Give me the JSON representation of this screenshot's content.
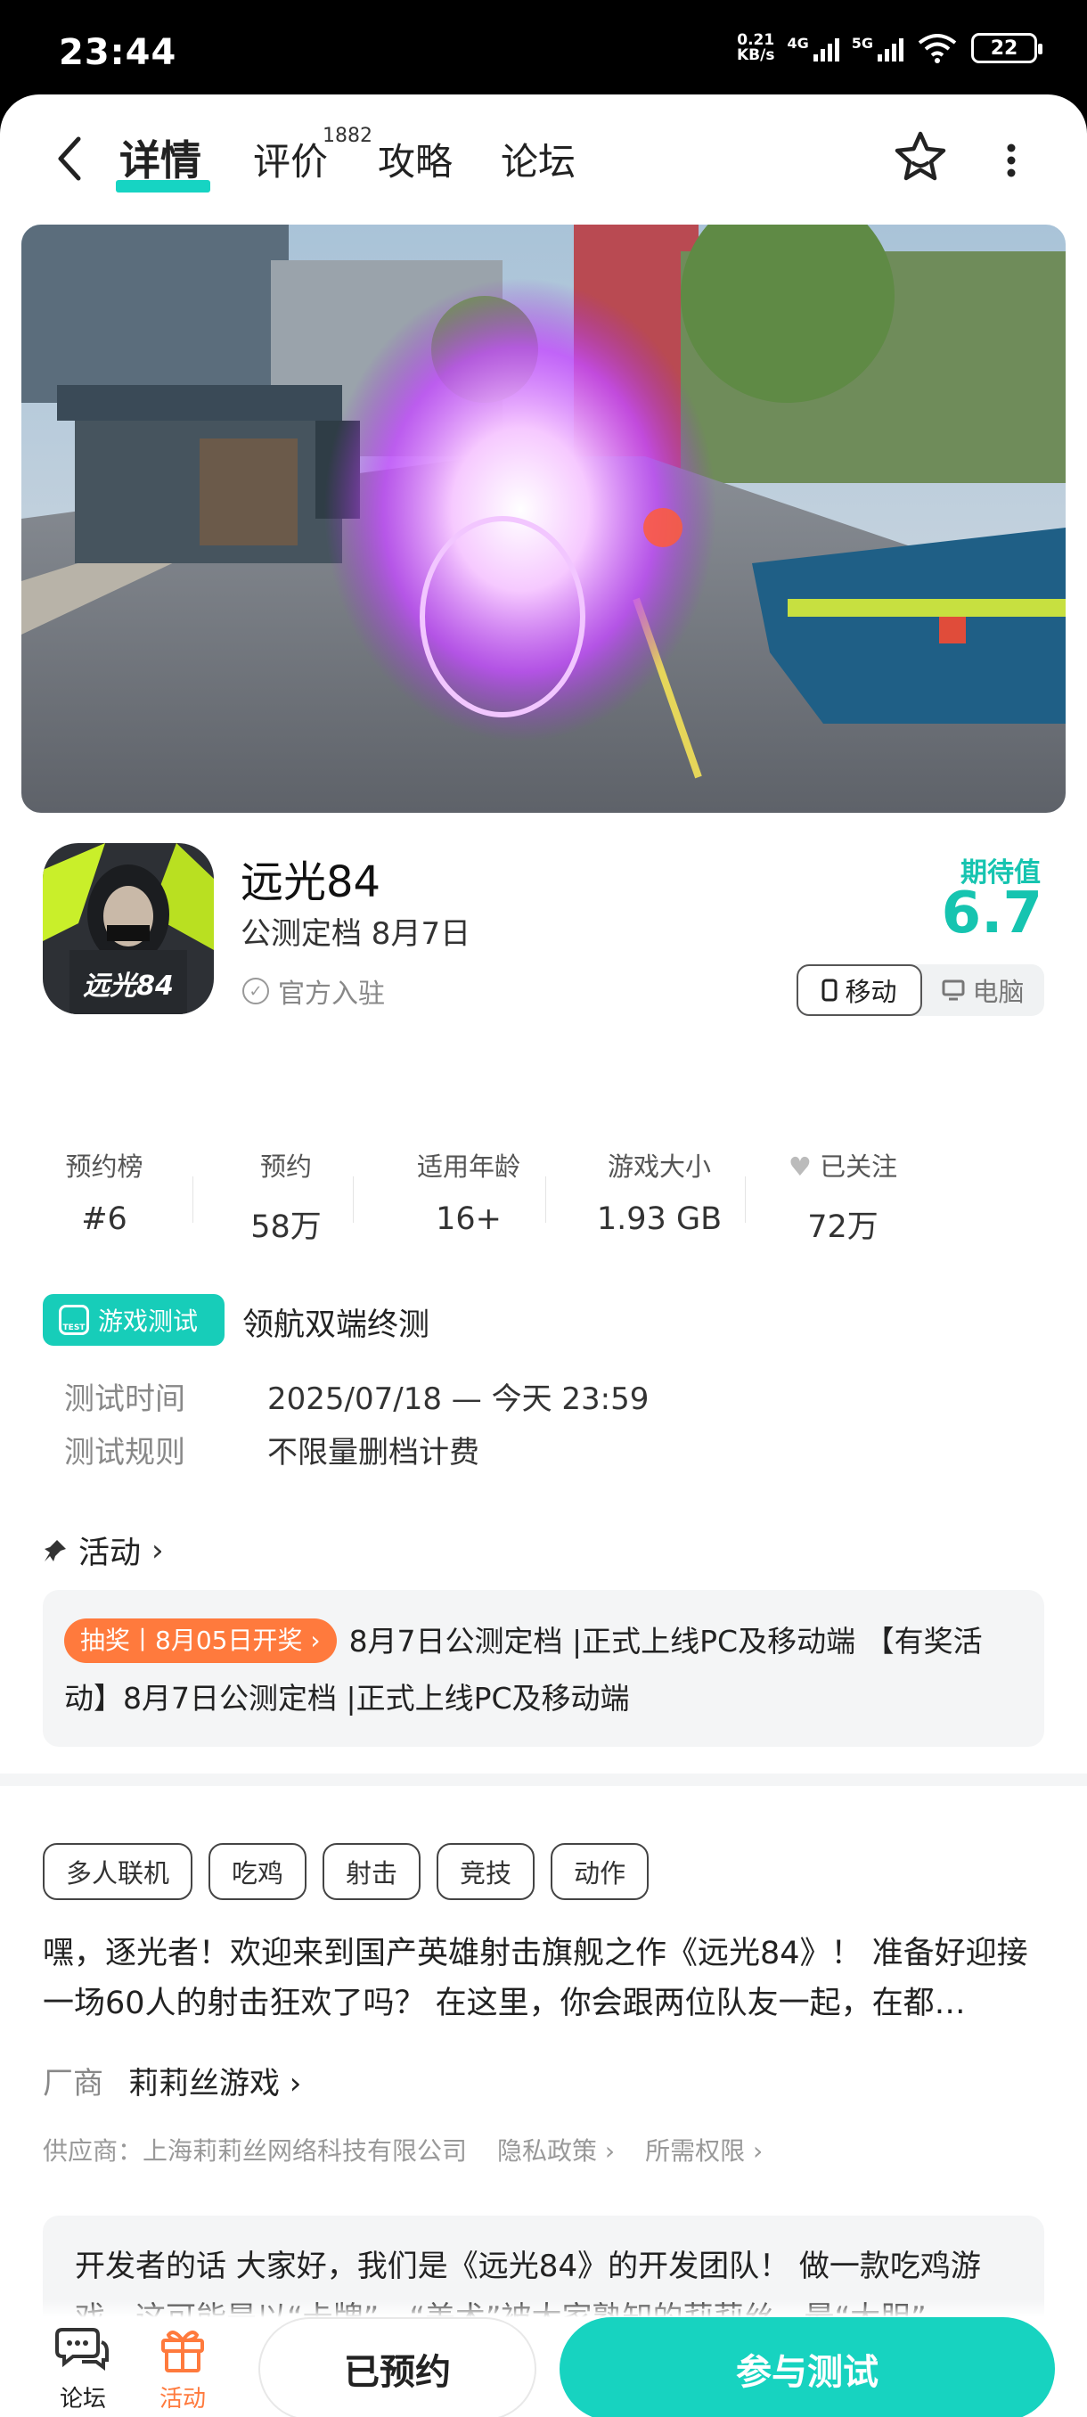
{
  "status_bar": {
    "time": "23:44",
    "net_speed_value": "0.21",
    "net_speed_unit": "KB/s",
    "sim1": "4G",
    "sim2": "5G",
    "battery": "22"
  },
  "nav": {
    "tabs": [
      "详情",
      "评价",
      "攻略",
      "论坛"
    ],
    "review_count": "1882"
  },
  "game": {
    "name": "远光84",
    "subtitle": "公测定档 8月7日",
    "official": "官方入驻",
    "expect_label": "期待值",
    "expect_score": "6.7",
    "platforms": [
      "移动",
      "电脑"
    ]
  },
  "stats": [
    {
      "label": "预约榜",
      "value": "#6"
    },
    {
      "label": "预约",
      "value": "58万"
    },
    {
      "label": "适用年龄",
      "value": "16+"
    },
    {
      "label": "游戏大小",
      "value": "1.93 GB"
    },
    {
      "label": "已关注",
      "value": "72万"
    }
  ],
  "test": {
    "badge": "游戏测试",
    "badge_icon_text": "TEST",
    "title": "领航双端终测",
    "rows": [
      {
        "key": "测试时间",
        "value": "2025/07/18 — 今天 23:59"
      },
      {
        "key": "测试规则",
        "value": "不限量删档计费"
      }
    ]
  },
  "activity": {
    "heading": "活动",
    "tag": "抽奖丨8月05日开奖",
    "text": "8月7日公测定档 |正式上线PC及移动端 【有奖活动】8月7日公测定档 |正式上线PC及移动端"
  },
  "tags": [
    "多人联机",
    "吃鸡",
    "射击",
    "竞技",
    "动作"
  ],
  "description": "嘿，逐光者！欢迎来到国产英雄射击旗舰之作《远光84》！ 准备好迎接一场60人的射击狂欢了吗？ 在这里，你会跟两位队友一起，在都…",
  "vendor": {
    "label": "厂商",
    "value": "莉莉丝游戏"
  },
  "supplier": {
    "text": "供应商：上海莉莉丝网络科技有限公司",
    "privacy": "隐私政策",
    "permissions": "所需权限"
  },
  "dev_note": "开发者的话  大家好，我们是《远光84》的开发团队！ 做一款吃鸡游戏，这可能是以“卡牌”、“美术”被大家熟知的莉莉丝，最“大胆”",
  "bottom": {
    "forum": "论坛",
    "activity": "活动",
    "reserved": "已预约",
    "join": "参与测试"
  },
  "colors": {
    "accent": "#17d3c0",
    "orange": "#ff7a3d"
  }
}
